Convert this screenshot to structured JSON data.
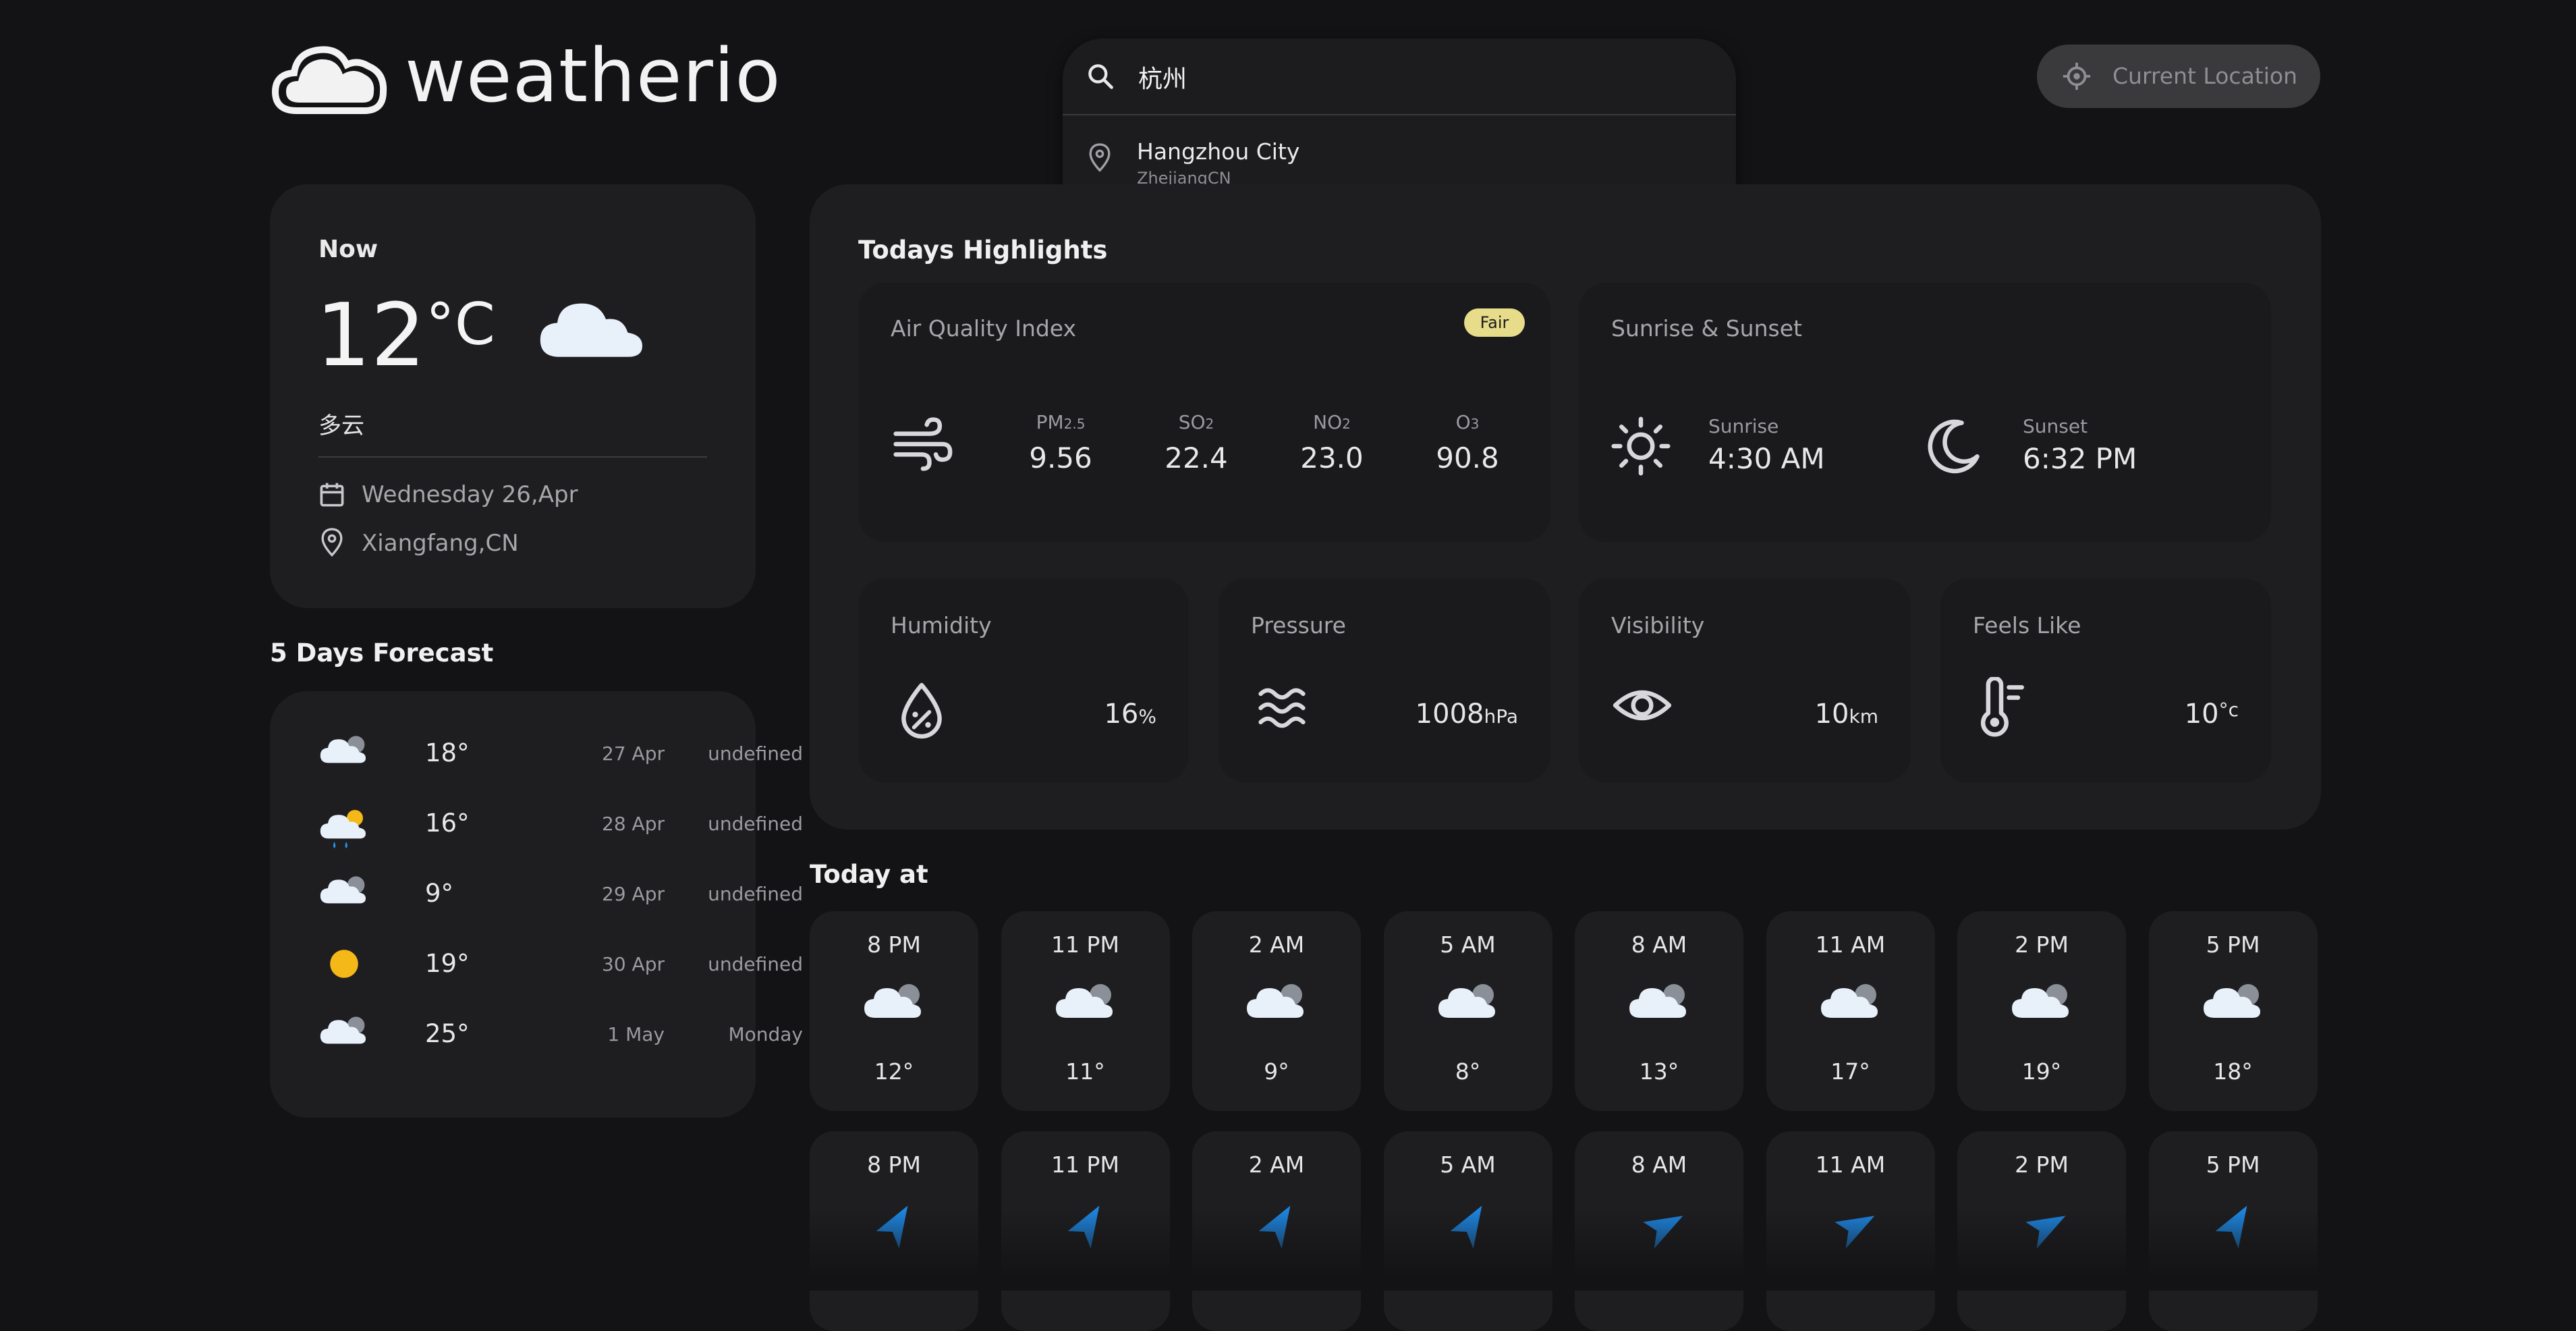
{
  "app": {
    "name": "weatherio"
  },
  "search": {
    "value": "杭州",
    "result": {
      "name": "Hangzhou City",
      "sub": "ZhejiangCN"
    }
  },
  "header": {
    "current_location": "Current Location"
  },
  "now": {
    "title": "Now",
    "temp": "12",
    "unit": "°C",
    "condition": "多云",
    "date": "Wednesday 26,Apr",
    "location": "Xiangfang,CN"
  },
  "forecast": {
    "title": "5 Days Forecast",
    "items": [
      {
        "icon": "cloud-icon",
        "temp": "18°",
        "date": "27 Apr",
        "day": "undefined"
      },
      {
        "icon": "rain-sun-icon",
        "temp": "16°",
        "date": "28 Apr",
        "day": "undefined"
      },
      {
        "icon": "cloud-icon",
        "temp": "9°",
        "date": "29 Apr",
        "day": "undefined"
      },
      {
        "icon": "sun-icon",
        "temp": "19°",
        "date": "30 Apr",
        "day": "undefined"
      },
      {
        "icon": "cloud-icon",
        "temp": "25°",
        "date": "1 May",
        "day": "Monday"
      }
    ]
  },
  "highlights": {
    "title": "Todays Highlights",
    "aqi": {
      "title": "Air Quality Index",
      "badge": "Fair",
      "items": [
        {
          "label": "PM",
          "sub": "2.5",
          "value": "9.56"
        },
        {
          "label": "SO",
          "sub": "2",
          "value": "22.4"
        },
        {
          "label": "NO",
          "sub": "2",
          "value": "23.0"
        },
        {
          "label": "O",
          "sub": "3",
          "value": "90.8"
        }
      ]
    },
    "sun": {
      "title": "Sunrise & Sunset",
      "sunrise_label": "Sunrise",
      "sunrise": "4:30 AM",
      "sunset_label": "Sunset",
      "sunset": "6:32 PM"
    },
    "humidity": {
      "title": "Humidity",
      "value": "16",
      "unit": "%"
    },
    "pressure": {
      "title": "Pressure",
      "value": "1008",
      "unit": "hPa"
    },
    "visibility": {
      "title": "Visibility",
      "value": "10",
      "unit": "km"
    },
    "feels_like": {
      "title": "Feels Like",
      "value": "10",
      "unit": "°c"
    }
  },
  "today": {
    "title": "Today at",
    "temps": [
      {
        "time": "8 PM",
        "temp": "12°"
      },
      {
        "time": "11 PM",
        "temp": "11°"
      },
      {
        "time": "2 AM",
        "temp": "9°"
      },
      {
        "time": "5 AM",
        "temp": "8°"
      },
      {
        "time": "8 AM",
        "temp": "13°"
      },
      {
        "time": "11 AM",
        "temp": "17°"
      },
      {
        "time": "2 PM",
        "temp": "19°"
      },
      {
        "time": "5 PM",
        "temp": "18°"
      }
    ],
    "wind_times": [
      "8 PM",
      "11 PM",
      "2 AM",
      "5 AM",
      "8 AM",
      "11 AM",
      "2 PM",
      "5 PM"
    ]
  },
  "colors": {
    "background": "#131315",
    "card": "#1e1e20",
    "accent_badge": "#e6dc8a",
    "wind_arrow": "#1e88e5",
    "sun": "#f5b819"
  }
}
